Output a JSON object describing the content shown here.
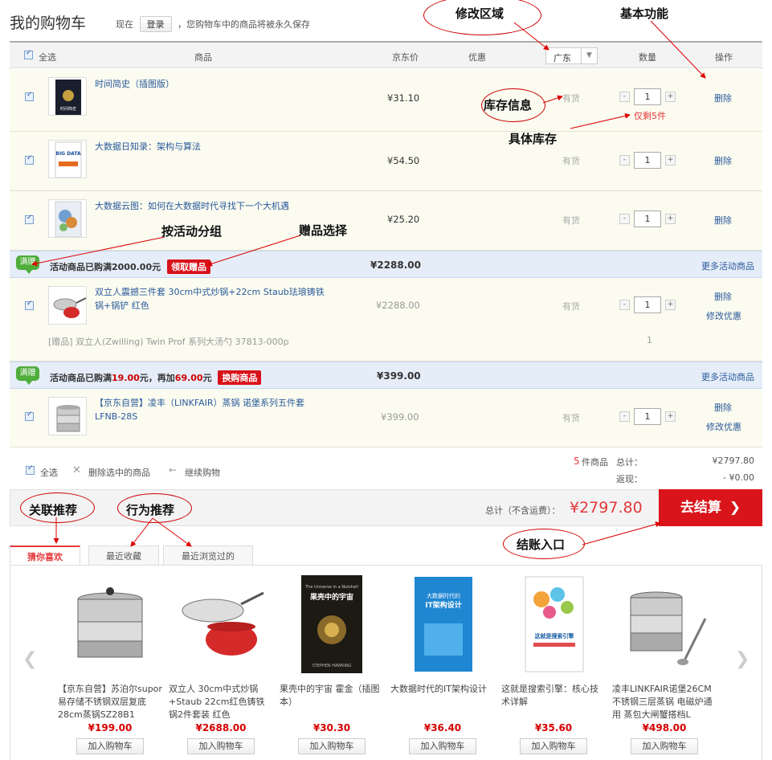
{
  "header": {
    "title": "我的购物车",
    "note_prefix": "现在",
    "login_label": "登录",
    "note_suffix": "，您购物车中的商品将被永久保存"
  },
  "table_header": {
    "select_all": "全选",
    "product": "商品",
    "jd_price": "京东价",
    "discount": "优惠",
    "region": "广东",
    "quantity": "数量",
    "operation": "操作"
  },
  "items": [
    {
      "name": "时间简史（插图版）",
      "price": "¥31.10",
      "stock": "有货",
      "qty": "1",
      "op": "删除",
      "stock_note": "仅剩5件"
    },
    {
      "name": "大数据日知录：架构与算法",
      "price": "¥54.50",
      "stock": "有货",
      "qty": "1",
      "op": "删除"
    },
    {
      "name": "大数据云图：如何在大数据时代寻找下一个大机遇",
      "price": "¥25.20",
      "stock": "有货",
      "qty": "1",
      "op": "删除"
    },
    {
      "name": "双立人震撼三件套 30cm中式炒锅+22cm Staub珐琅铸铁锅+锅铲 红色",
      "price": "¥2288.00",
      "stock": "有货",
      "qty": "1",
      "op": "删除",
      "op2": "修改优惠",
      "gift": "[赠品] 双立人(Zwilling) Twin Prof 系列大汤勺 37813-000p",
      "gift_qty": "1"
    },
    {
      "name": "【京东自营】凌丰（LINKFAIR）蒸锅 诺堡系列五件套 LFNB-28S",
      "price": "¥399.00",
      "stock": "有货",
      "qty": "1",
      "op": "删除",
      "op2": "修改优惠"
    }
  ],
  "promos": [
    {
      "badge": "满赠",
      "text": "活动商品已购满2000.00元",
      "tag": "领取赠品",
      "total": "¥2288.00",
      "more": "更多活动商品"
    },
    {
      "badge": "满赠",
      "text_a": "活动商品已购满",
      "amount_a": "19.00",
      "text_b": "元，再加",
      "amount_b": "69.00",
      "text_c": "元",
      "tag": "换购商品",
      "total": "¥399.00",
      "more": "更多活动商品"
    }
  ],
  "footer": {
    "select_all": "全选",
    "delete_selected": "删除选中的商品",
    "continue": "继续购物",
    "count": "5",
    "count_unit": "件商品",
    "total_label": "总计：",
    "total": "¥2797.80",
    "rebate_label": "返现：",
    "rebate": "- ¥0.00"
  },
  "checkout": {
    "label": "总计（不含运费）：",
    "amount": "¥2797.80",
    "button": "去结算"
  },
  "tabs": [
    "猜你喜欢",
    "最近收藏",
    "最近浏览过的"
  ],
  "recs": [
    {
      "name": "【京东自营】苏泊尔supor易存储不锈钢双层复底28cm蒸锅SZ28B1",
      "price": "¥199.00",
      "btn": "加入购物车"
    },
    {
      "name": "双立人 30cm中式炒锅+Staub 22cm红色铸铁锅2件套装 红色",
      "price": "¥2688.00",
      "btn": "加入购物车"
    },
    {
      "name": "果壳中的宇宙 霍金（插图本）",
      "price": "¥30.30",
      "btn": "加入购物车"
    },
    {
      "name": "大数据时代的IT架构设计",
      "price": "¥36.40",
      "btn": "加入购物车"
    },
    {
      "name": "这就是搜索引擎：核心技术详解",
      "price": "¥35.60",
      "btn": "加入购物车"
    },
    {
      "name": "凌丰LINKFAIR诺堡26CM不锈钢三层蒸锅 电磁炉通用 蒸包大闸蟹搭档L",
      "price": "¥498.00",
      "btn": "加入购物车"
    }
  ],
  "annotations": {
    "region": "修改区域",
    "basic": "基本功能",
    "stock_info": "库存信息",
    "stock_detail": "具体库存",
    "group": "按活动分组",
    "gift": "赠品选择",
    "related": "关联推荐",
    "behavior": "行为推荐",
    "checkout_entry": "结账入口"
  },
  "book_text": {
    "b1": "时间简史",
    "b2": "BIG DATA",
    "b3": "The Universe in a Nutshell",
    "b3b": "果壳中的宇宙",
    "b3c": "STEPHEN HAWKING",
    "b4a": "大数据时代的",
    "b4b": "IT架构设计",
    "b5": "这就是搜索引擎"
  }
}
